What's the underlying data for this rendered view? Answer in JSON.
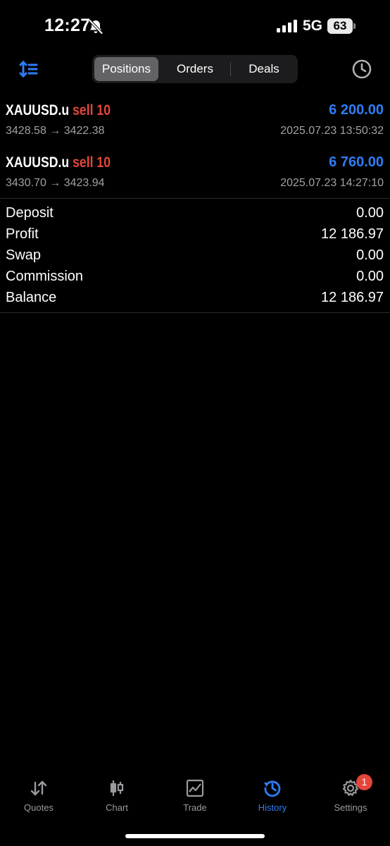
{
  "status_bar": {
    "time": "12:27",
    "network": "5G",
    "battery": "63"
  },
  "toolbar": {
    "tabs": [
      "Positions",
      "Orders",
      "Deals"
    ],
    "active_tab": "Positions"
  },
  "deals": [
    {
      "symbol": "XAUUSD.u",
      "side": "sell 10",
      "profit": "6 200.00",
      "prices": "3428.58 → 3422.38",
      "time": "2025.07.23 13:50:32"
    },
    {
      "symbol": "XAUUSD.u",
      "side": "sell 10",
      "profit": "6 760.00",
      "prices": "3430.70 → 3423.94",
      "time": "2025.07.23 14:27:10"
    }
  ],
  "summary": [
    {
      "label": "Deposit",
      "value": "0.00"
    },
    {
      "label": "Profit",
      "value": "12 186.97"
    },
    {
      "label": "Swap",
      "value": "0.00"
    },
    {
      "label": "Commission",
      "value": "0.00"
    },
    {
      "label": "Balance",
      "value": "12 186.97"
    }
  ],
  "tab_bar": {
    "items": [
      {
        "label": "Quotes",
        "icon": "quotes-arrows-icon"
      },
      {
        "label": "Chart",
        "icon": "candlestick-icon"
      },
      {
        "label": "Trade",
        "icon": "trade-chart-icon"
      },
      {
        "label": "History",
        "icon": "history-icon"
      },
      {
        "label": "Settings",
        "icon": "gear-icon"
      }
    ],
    "active": "History",
    "settings_badge": "1"
  },
  "colors": {
    "accent": "#2f7df6",
    "sell": "#e3463c",
    "background": "#000000",
    "muted": "#a1a1a6"
  }
}
